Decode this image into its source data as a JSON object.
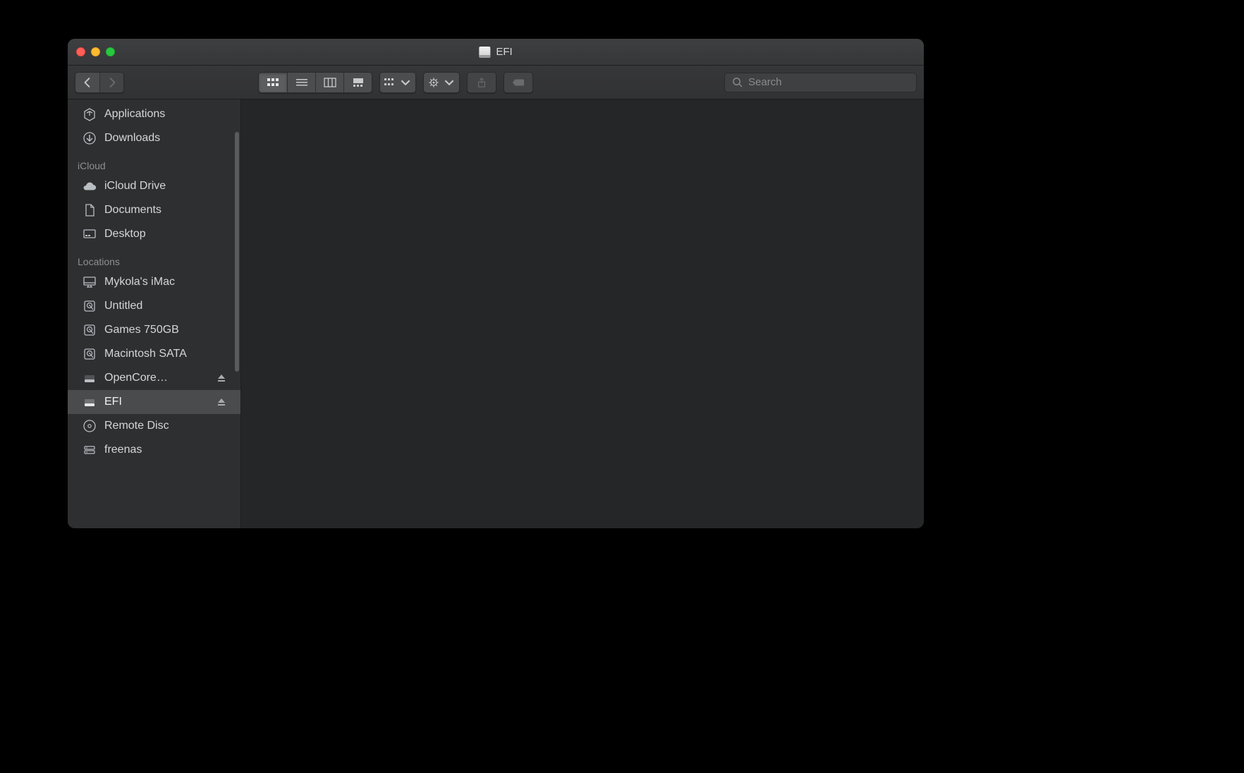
{
  "window": {
    "title": "EFI"
  },
  "search": {
    "placeholder": "Search",
    "value": ""
  },
  "sidebar": {
    "favorites": [
      {
        "label": "Applications",
        "icon": "applications"
      },
      {
        "label": "Downloads",
        "icon": "downloads"
      }
    ],
    "icloud_label": "iCloud",
    "icloud": [
      {
        "label": "iCloud Drive",
        "icon": "cloud"
      },
      {
        "label": "Documents",
        "icon": "documents"
      },
      {
        "label": "Desktop",
        "icon": "desktop"
      }
    ],
    "locations_label": "Locations",
    "locations": [
      {
        "label": "Mykola's iMac",
        "icon": "imac",
        "eject": false
      },
      {
        "label": "Untitled",
        "icon": "hdd",
        "eject": false
      },
      {
        "label": "Games 750GB",
        "icon": "hdd",
        "eject": false
      },
      {
        "label": "Macintosh SATA",
        "icon": "hdd",
        "eject": false
      },
      {
        "label": "OpenCore…",
        "icon": "external",
        "eject": true
      },
      {
        "label": "EFI",
        "icon": "external",
        "eject": true,
        "selected": true
      },
      {
        "label": "Remote Disc",
        "icon": "disc",
        "eject": false
      },
      {
        "label": "freenas",
        "icon": "server",
        "eject": false
      }
    ]
  }
}
